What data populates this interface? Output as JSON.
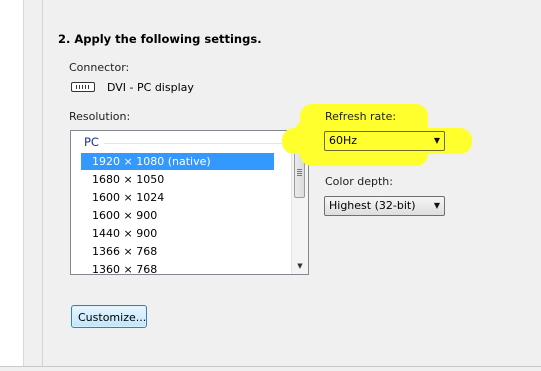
{
  "heading": "2. Apply the following settings.",
  "connector": {
    "label": "Connector:",
    "value": "DVI - PC display",
    "icon": "dvi-connector-icon"
  },
  "resolution": {
    "label": "Resolution:",
    "group": "PC",
    "items": [
      "1920 × 1080 (native)",
      "1680 × 1050",
      "1600 × 1024",
      "1600 × 900",
      "1440 × 900",
      "1366 × 768",
      "1360 × 768"
    ],
    "selected_index": 0
  },
  "refresh_rate": {
    "label": "Refresh rate:",
    "value": "60Hz"
  },
  "color_depth": {
    "label": "Color depth:",
    "value": "Highest (32-bit)"
  },
  "customize_button": "Customize...",
  "colors": {
    "highlight": "#ffff2e",
    "selection": "#3399ff",
    "group_header": "#1e3287"
  }
}
